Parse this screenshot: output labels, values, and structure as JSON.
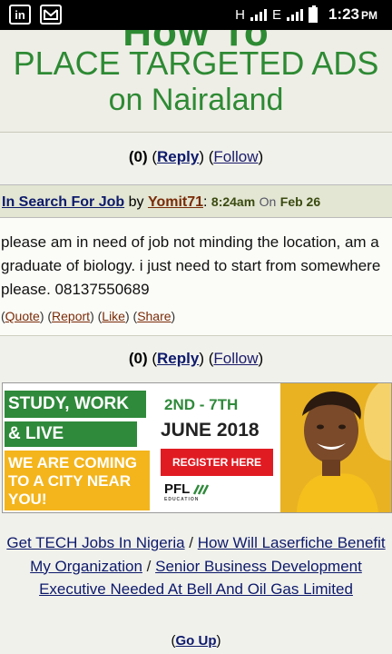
{
  "status_bar": {
    "time": "1:23",
    "ampm": "PM",
    "network_1": "H",
    "network_2": "E",
    "icons": [
      "linkedin-icon",
      "gmail-icon",
      "signal-icon",
      "battery-icon"
    ]
  },
  "top_banner": {
    "line1": "How To",
    "line2": "PLACE TARGETED ADS",
    "line3": "on Nairaland"
  },
  "counts_top": {
    "count": "(0)",
    "reply": "Reply",
    "follow": "Follow"
  },
  "post": {
    "topic": "In Search For Job",
    "by": "by",
    "user": "Yomit71",
    "time": "8:24am",
    "on": "On",
    "date": "Feb 26",
    "body": "please am in need of job not minding the location, am a graduate of biology. i just need to start from somewhere please. 08137550689",
    "actions": {
      "quote": "Quote",
      "report": "Report",
      "like": "Like",
      "share": "Share"
    }
  },
  "counts_bottom": {
    "count": "(0)",
    "reply": "Reply",
    "follow": "Follow"
  },
  "ad": {
    "line1": "STUDY, WORK",
    "line2": "& LIVE ABROAD",
    "line3": "WE ARE COMING TO A CITY NEAR YOU!",
    "dates1": "2ND - 7TH",
    "dates2": "JUNE 2018",
    "register": "REGISTER HERE",
    "logo": "PFL",
    "logo_sub": "EDUCATION",
    "colors": {
      "green": "#2f8a3b",
      "yellow": "#f4b51c",
      "red": "#e11b22"
    }
  },
  "footer": {
    "links": [
      "Get TECH Jobs In Nigeria",
      "How Will Laserfiche Benefit My Organization",
      "Senior Business Development Executive Needed At Bell And Oil Gas Limited"
    ],
    "separator": " / ",
    "go_up": "Go Up"
  }
}
